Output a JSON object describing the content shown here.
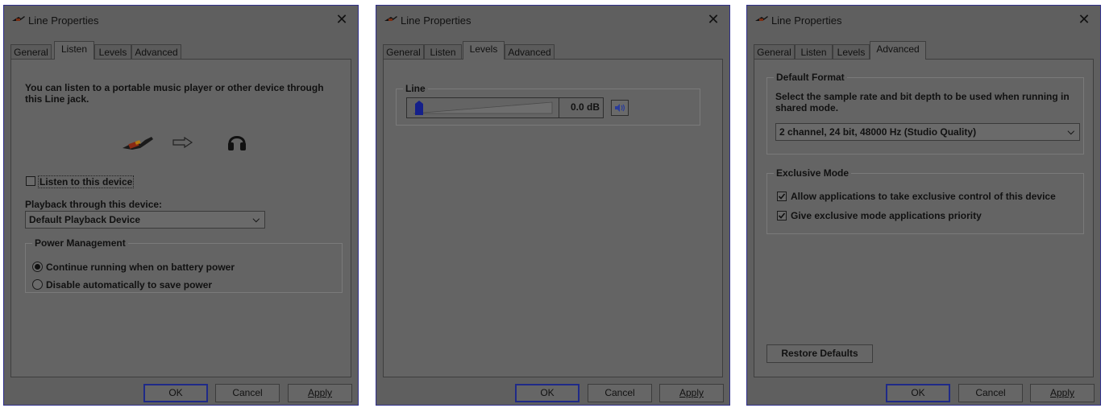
{
  "dialogs": [
    {
      "title": "Line Properties",
      "close_glyph": "✕",
      "tabs": [
        "General",
        "Listen",
        "Levels",
        "Advanced"
      ],
      "active_tab": "Listen",
      "listen": {
        "description": "You can listen to a portable music player or other device through this Line jack.",
        "listen_checkbox_label": "Listen to this device",
        "listen_checked": false,
        "playback_label": "Playback through this device:",
        "playback_value": "Default Playback Device",
        "power_group_label": "Power Management",
        "radio_continue": "Continue running when on battery power",
        "radio_disable": "Disable automatically to save power",
        "selected_radio": "continue"
      },
      "buttons": {
        "ok": "OK",
        "cancel": "Cancel",
        "apply": "Apply"
      }
    },
    {
      "title": "Line Properties",
      "close_glyph": "✕",
      "tabs": [
        "General",
        "Listen",
        "Levels",
        "Advanced"
      ],
      "active_tab": "Levels",
      "levels": {
        "line_group_label": "Line",
        "level_value": "0.0 dB",
        "slider_level": 0.0
      },
      "buttons": {
        "ok": "OK",
        "cancel": "Cancel",
        "apply": "Apply"
      }
    },
    {
      "title": "Line Properties",
      "close_glyph": "✕",
      "tabs": [
        "General",
        "Listen",
        "Levels",
        "Advanced"
      ],
      "active_tab": "Advanced",
      "advanced": {
        "default_format_label": "Default Format",
        "default_format_desc": "Select the sample rate and bit depth to be used when running in shared mode.",
        "format_value": "2 channel, 24 bit, 48000 Hz (Studio Quality)",
        "exclusive_label": "Exclusive Mode",
        "exclusive_control": "Allow applications to take exclusive control of this device",
        "exclusive_control_checked": true,
        "exclusive_priority": "Give exclusive mode applications priority",
        "exclusive_priority_checked": true,
        "restore_defaults": "Restore Defaults"
      },
      "buttons": {
        "ok": "OK",
        "cancel": "Cancel",
        "apply": "Apply"
      }
    }
  ],
  "colors": {
    "dialog_bg": "#5f5f5f",
    "panel_bg": "#646464",
    "default_button_border": "#1f2a88",
    "speaker_icon": "#2a3c9a",
    "slider_thumb": "#15208a"
  },
  "icons": [
    "line-jack-icon",
    "arrow-right-icon",
    "headphones-icon",
    "speaker-icon",
    "chevron-down-icon",
    "close-icon"
  ]
}
